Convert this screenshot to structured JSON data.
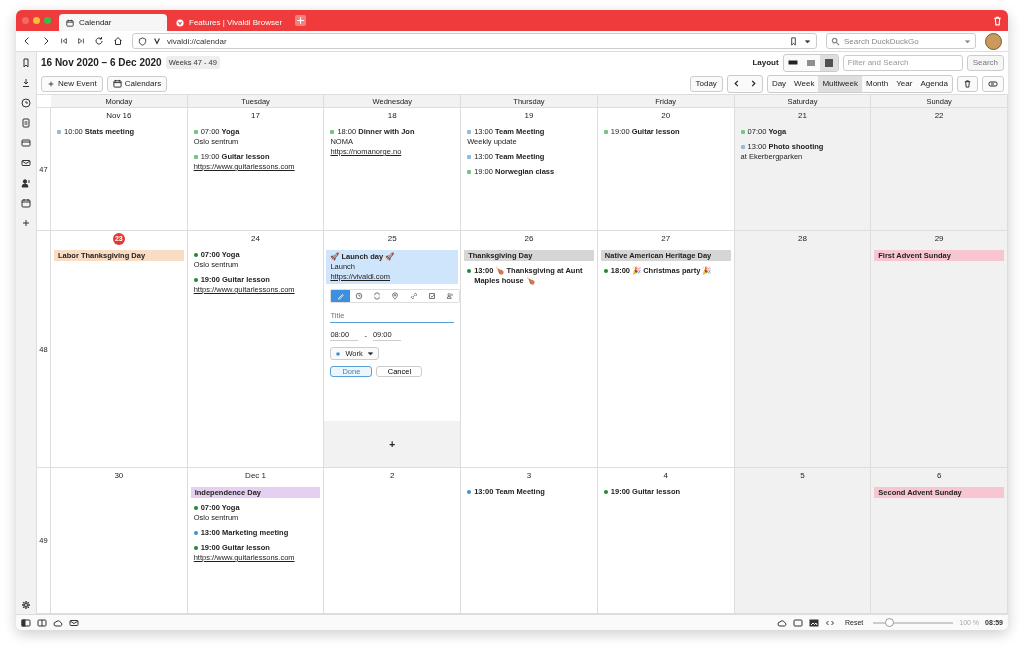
{
  "tabs": [
    {
      "label": "Calendar",
      "selected": true
    },
    {
      "label": "Features | Vivaldi Browser",
      "selected": false
    }
  ],
  "address": {
    "url": "vivaldi://calendar"
  },
  "search": {
    "placeholder": "Search DuckDuckGo"
  },
  "calendar": {
    "title": "16 Nov 2020 – 6 Dec 2020",
    "weeks_badge": "Weeks 47 - 49",
    "layout_label": "Layout",
    "layouts": [
      {
        "selected": false
      },
      {
        "selected": false
      },
      {
        "selected": true
      }
    ],
    "filter": {
      "placeholder": "Filter and Search"
    },
    "search_button": "Search",
    "new_event": "New Event",
    "calendars_button": "Calendars",
    "today_button": "Today",
    "views": [
      {
        "label": "Day",
        "selected": false
      },
      {
        "label": "Week",
        "selected": false
      },
      {
        "label": "Multiweek",
        "selected": true
      },
      {
        "label": "Month",
        "selected": false
      },
      {
        "label": "Year",
        "selected": false
      },
      {
        "label": "Agenda",
        "selected": false
      }
    ],
    "weekdays": [
      "Monday",
      "Tuesday",
      "Wednesday",
      "Thursday",
      "Friday",
      "Saturday",
      "Sunday"
    ],
    "weeks": [
      {
        "number": "47",
        "days": [
          {
            "date": "Nov 16",
            "today": false,
            "weekend": false,
            "events": [
              {
                "kind": "past",
                "text": "10:00 **Stats meeting**",
                "color": "#8fbce3"
              }
            ]
          },
          {
            "date": "17",
            "today": false,
            "weekend": false,
            "events": [
              {
                "kind": "past",
                "text": "07:00 **Yoga**",
                "color": "#7cc382",
                "notes": [
                  "Oslo sentrum"
                ]
              },
              {
                "kind": "past",
                "text": "19:00 **Guitar lesson**",
                "color": "#7cc382",
                "link": "https://www.guitarlessons.com"
              }
            ]
          },
          {
            "date": "18",
            "today": false,
            "weekend": false,
            "events": [
              {
                "kind": "past",
                "text": "18:00 **Dinner with Jon**",
                "color": "#7cc382",
                "notes": [
                  "NOMA"
                ],
                "link": "https://nomanorge.no"
              }
            ]
          },
          {
            "date": "19",
            "today": false,
            "weekend": false,
            "events": [
              {
                "kind": "past",
                "text": "13:00 **Team Meeting**",
                "color": "#8fbce3",
                "notes": [
                  "Weekly update"
                ]
              },
              {
                "kind": "past",
                "text": "13:00 **Team Meeting**",
                "color": "#8fbce3"
              },
              {
                "kind": "past",
                "text": "19:00 **Norwegian class**",
                "color": "#7cc382"
              }
            ]
          },
          {
            "date": "20",
            "today": false,
            "weekend": false,
            "events": [
              {
                "kind": "past",
                "text": "19:00 **Guitar lesson**",
                "color": "#7cc382"
              }
            ]
          },
          {
            "date": "21",
            "today": false,
            "weekend": true,
            "events": [
              {
                "kind": "past",
                "text": "07:00 **Yoga**",
                "color": "#7cc382"
              },
              {
                "kind": "past",
                "text": "13:00 **Photo shooting**",
                "color": "#8fbce3",
                "notes": [
                  "at Ekerbergparken"
                ]
              }
            ]
          },
          {
            "date": "22",
            "today": false,
            "weekend": true
          }
        ]
      },
      {
        "number": "48",
        "days": [
          {
            "date": "23",
            "today": true,
            "weekend": false,
            "events": [
              {
                "kind": "allday",
                "text": "Labor Thanksgiving Day",
                "color": "#f9dcc4"
              }
            ]
          },
          {
            "date": "24",
            "today": false,
            "weekend": false,
            "events": [
              {
                "kind": "timed",
                "text": "07:00 Yoga",
                "color": "#1e8a2e",
                "notes": [
                  "Oslo sentrum"
                ]
              },
              {
                "kind": "timed",
                "text": "19:00 Guitar lesson",
                "color": "#1e8a2e",
                "link": "https://www.guitarlessons.com"
              }
            ]
          },
          {
            "date": "25",
            "today": false,
            "weekend": false,
            "events": [
              {
                "kind": "draft",
                "text": "🚀 Launch day 🚀",
                "notes": [
                  "Launch"
                ],
                "link": "https://vivaldi.com"
              }
            ],
            "editor": {
              "tools": [
                {
                  "selected": true
                },
                {
                  "selected": false
                },
                {
                  "selected": false
                },
                {
                  "selected": false
                },
                {
                  "selected": false
                },
                {
                  "selected": false
                },
                {
                  "selected": false
                }
              ],
              "title_placeholder": "Title",
              "start": "08:00",
              "separator": "-",
              "end": "09:00",
              "calendar": "Work",
              "done": "Done",
              "cancel": "Cancel"
            },
            "add_button": "+"
          },
          {
            "date": "26",
            "today": false,
            "weekend": false,
            "events": [
              {
                "kind": "allday",
                "text": "Thanksgiving Day",
                "color": "#d6d6d6"
              },
              {
                "kind": "timed",
                "text": "13:00 🍗 Thanksgiving at Aunt Maples house 🍗",
                "color": "#1e8a2e"
              }
            ]
          },
          {
            "date": "27",
            "today": false,
            "weekend": false,
            "events": [
              {
                "kind": "allday",
                "text": "Native American Heritage Day",
                "color": "#d6d6d6"
              },
              {
                "kind": "timed",
                "text": "18:00 🎉 Christmas party 🎉",
                "color": "#1e8a2e"
              }
            ]
          },
          {
            "date": "28",
            "today": false,
            "weekend": true
          },
          {
            "date": "29",
            "today": false,
            "weekend": true,
            "events": [
              {
                "kind": "allday",
                "text": "First Advent Sunday",
                "color": "#f7c6d0"
              }
            ]
          }
        ]
      },
      {
        "number": "49",
        "days": [
          {
            "date": "30",
            "today": false,
            "weekend": false
          },
          {
            "date": "Dec  1",
            "today": false,
            "weekend": false,
            "events": [
              {
                "kind": "allday",
                "text": "Independence Day",
                "color": "#e6d0f2"
              },
              {
                "kind": "timed",
                "text": "07:00 Yoga",
                "color": "#1e8a2e",
                "notes": [
                  "Oslo sentrum"
                ]
              },
              {
                "kind": "timed",
                "text": "13:00 Marketing meeting",
                "color": "#3d8fe0"
              },
              {
                "kind": "timed",
                "text": "19:00 Guitar lesson",
                "color": "#1e8a2e",
                "link": "https://www.guitarlessons.com"
              }
            ]
          },
          {
            "date": "2",
            "today": false,
            "weekend": false
          },
          {
            "date": "3",
            "today": false,
            "weekend": false,
            "events": [
              {
                "kind": "timed",
                "text": "13:00 Team Meeting",
                "color": "#3d8fe0"
              }
            ]
          },
          {
            "date": "4",
            "today": false,
            "weekend": false,
            "events": [
              {
                "kind": "timed",
                "text": "19:00 Guitar lesson",
                "color": "#1e8a2e"
              }
            ]
          },
          {
            "date": "5",
            "today": false,
            "weekend": true
          },
          {
            "date": "6",
            "today": false,
            "weekend": true,
            "events": [
              {
                "kind": "allday",
                "text": "Second Advent Sunday",
                "color": "#f7c6d0"
              }
            ]
          }
        ]
      }
    ]
  },
  "status_bar": {
    "reset": "Reset",
    "zoom": {
      "level": 0.15
    },
    "zoom_reading": "100 %",
    "clock": "08:59"
  }
}
